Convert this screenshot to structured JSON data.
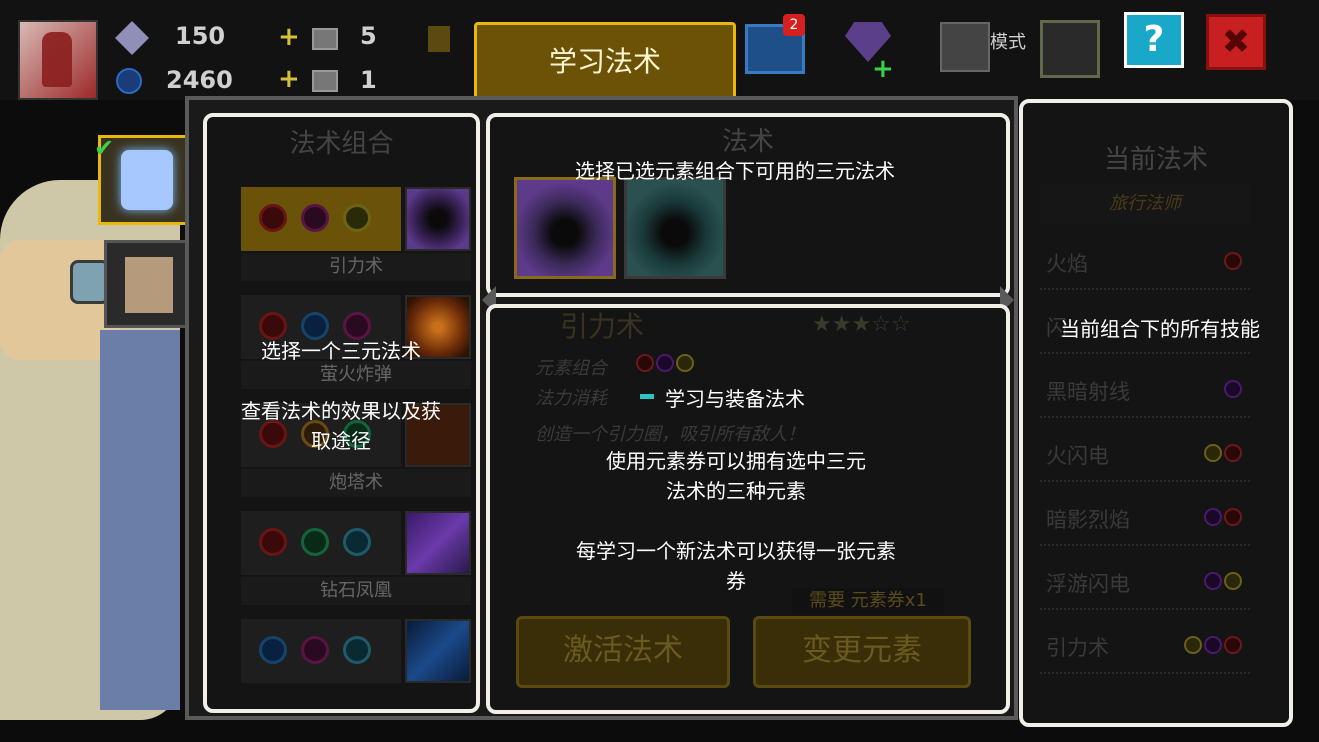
{
  "hud": {
    "gems": "150",
    "gem_tickets": "5",
    "coins": "2460",
    "coin_tickets": "1",
    "learn_tab_label": "学习法术",
    "chest_badge": "2",
    "mode_label": "模式",
    "help_label": "?",
    "close_label": "✖"
  },
  "left_panel": {
    "title": "法术组合",
    "spells": [
      {
        "name": "引力术",
        "elements": [
          "fire",
          "dark",
          "thunder"
        ],
        "selected": true
      },
      {
        "name": "萤火炸弹",
        "elements": [
          "fire",
          "water",
          "dark"
        ],
        "selected": false
      },
      {
        "name": "炮塔术",
        "elements": [
          "fire",
          "light",
          "earth"
        ],
        "selected": false
      },
      {
        "name": "钻石凤凰",
        "elements": [
          "fire",
          "earth",
          "ice"
        ],
        "selected": false
      },
      {
        "name": "",
        "elements": [
          "water",
          "dark",
          "ice"
        ],
        "selected": false
      }
    ]
  },
  "mid_top": {
    "title": "法术"
  },
  "mid_bottom": {
    "spell_title": "引力术",
    "stars": "★★★☆☆",
    "element_label": "元素组合",
    "mana_label": "法力消耗",
    "description": "创造一个引力圈，吸引所有敌人！",
    "need_label": "需要 元素券x1",
    "activate_label": "激活法术",
    "change_label": "变更元素"
  },
  "right_panel": {
    "title": "当前法术",
    "subtitle": "旅行法师",
    "skills": [
      {
        "name": "火焰",
        "elements": [
          "fire"
        ]
      },
      {
        "name": "闪",
        "elements": []
      },
      {
        "name": "黑暗射线",
        "elements": [
          "dark"
        ]
      },
      {
        "name": "火闪电",
        "elements": [
          "thunder",
          "fire"
        ]
      },
      {
        "name": "暗影烈焰",
        "elements": [
          "dark",
          "fire"
        ]
      },
      {
        "name": "浮游闪电",
        "elements": [
          "dark",
          "thunder"
        ]
      },
      {
        "name": "引力术",
        "elements": [
          "thunder",
          "dark",
          "fire"
        ]
      }
    ]
  },
  "tips": {
    "mid_top_tip": "选择已选元素组合下可用的三元法术",
    "left_tip_1": "选择一个三元法术",
    "left_tip_2": "查看法术的效果以及获取途径",
    "mid_tip_1": "学习与装备法术",
    "mid_tip_2": "使用元素券可以拥有选中三元法术的三种元素",
    "mid_tip_3": "每学习一个新法术可以获得一张元素券",
    "right_tip": "当前组合下的所有技能"
  },
  "colors": {
    "accent_gold": "#e8b80c",
    "panel_border": "#f1efe6"
  }
}
